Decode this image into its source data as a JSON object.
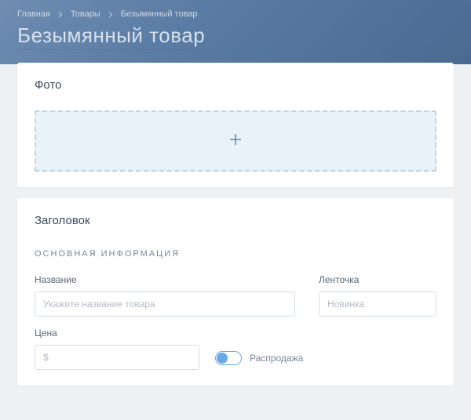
{
  "breadcrumb": {
    "items": [
      "Главная",
      "Товары",
      "Безымянный товар"
    ]
  },
  "page_title": "Безымянный товар",
  "photo_card": {
    "heading": "Фото"
  },
  "info_card": {
    "heading": "Заголовок",
    "section_label": "ОСНОВНАЯ ИНФОРМАЦИЯ",
    "name": {
      "label": "Название",
      "placeholder": "Укажите название товара"
    },
    "ribbon": {
      "label": "Ленточка",
      "placeholder": "Новинка"
    },
    "price": {
      "label": "Цена",
      "placeholder": "$"
    },
    "sale_toggle": {
      "label": "Распродажа"
    }
  }
}
